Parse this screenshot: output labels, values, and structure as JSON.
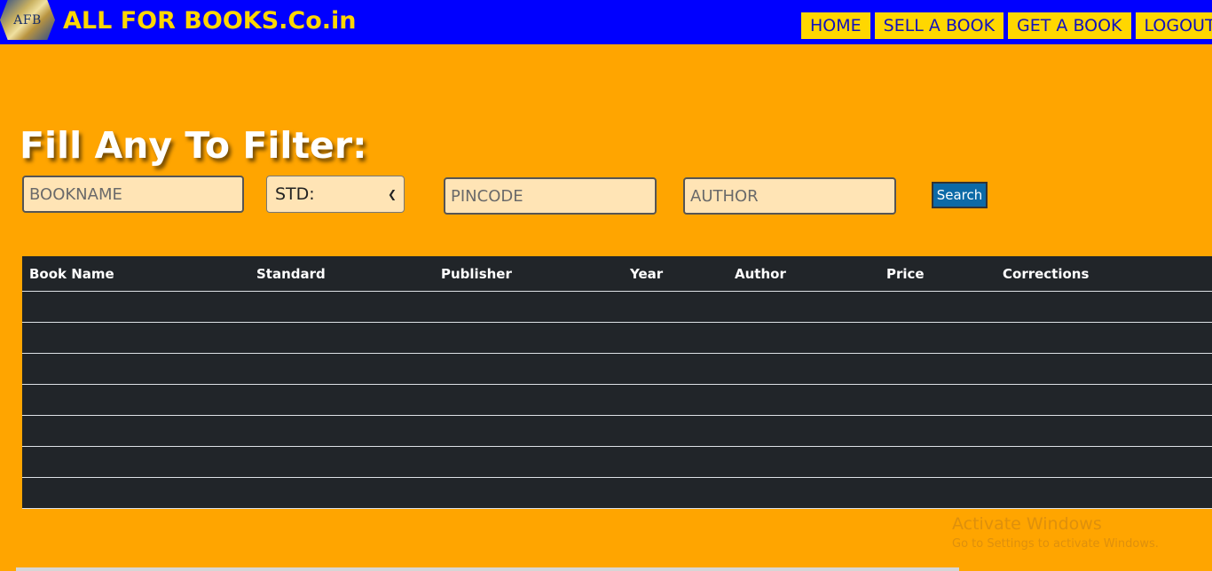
{
  "header": {
    "logo_text": "AFB",
    "brand": "ALL FOR BOOKS.Co.in",
    "nav": [
      "HOME",
      "SELL A BOOK",
      "GET A BOOK",
      "LOGOUT"
    ]
  },
  "filter": {
    "heading": "Fill Any To Filter:",
    "bookname_placeholder": "BOOKNAME",
    "std_selected": "STD:",
    "pincode_placeholder": "PINCODE",
    "author_placeholder": "AUTHOR",
    "search_label": "Search"
  },
  "table": {
    "columns": [
      "Book Name",
      "Standard",
      "Publisher",
      "Year",
      "Author",
      "Price",
      "Corrections"
    ]
  },
  "watermark": {
    "line1": "Activate Windows",
    "line2": "Go to Settings to activate Windows."
  },
  "colors": {
    "page_bg": "#ffa500",
    "header_bg": "#0000ff",
    "brand": "#ffd700",
    "table_bg": "#212529",
    "search_button": "#0d6aa7"
  }
}
